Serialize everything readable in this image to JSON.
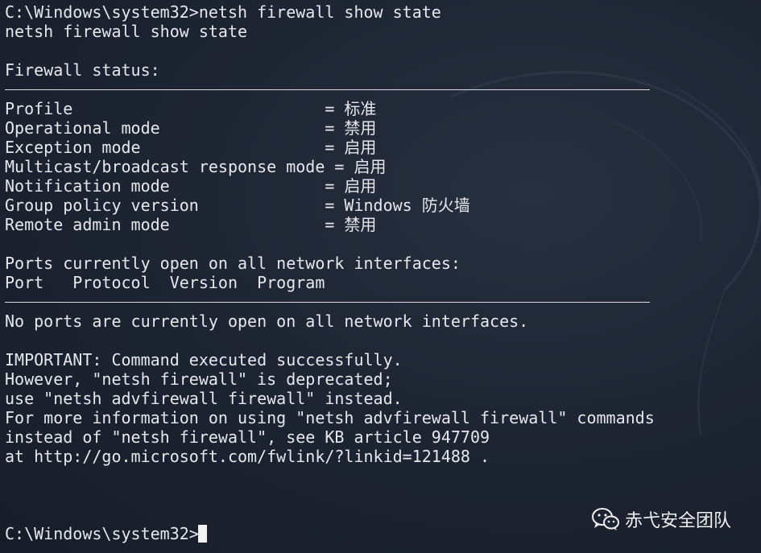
{
  "terminal": {
    "lines": [
      "C:\\Windows\\system32>netsh firewall show state",
      "netsh firewall show state",
      "",
      "Firewall status:",
      "",
      "Profile                          = 标准",
      "Operational mode                 = 禁用",
      "Exception mode                   = 启用",
      "Multicast/broadcast response mode = 启用",
      "Notification mode                = 启用",
      "Group policy version             = Windows 防火墙",
      "Remote admin mode                = 禁用",
      "",
      "Ports currently open on all network interfaces:",
      "Port   Protocol  Version  Program",
      "",
      "No ports are currently open on all network interfaces.",
      "",
      "IMPORTANT: Command executed successfully.",
      "However, \"netsh firewall\" is deprecated;",
      "use \"netsh advfirewall firewall\" instead.",
      "For more information on using \"netsh advfirewall firewall\" commands",
      "instead of \"netsh firewall\", see KB article 947709",
      "at http://go.microsoft.com/fwlink/?linkid=121488 .",
      "",
      "",
      "",
      "C:\\Windows\\system32>"
    ]
  },
  "watermark": {
    "icon": "wechat-icon",
    "text": "赤弋安全团队"
  },
  "colors": {
    "background": "#1e2533",
    "text": "#e6e8ec",
    "cursor": "#f2f2f2"
  }
}
